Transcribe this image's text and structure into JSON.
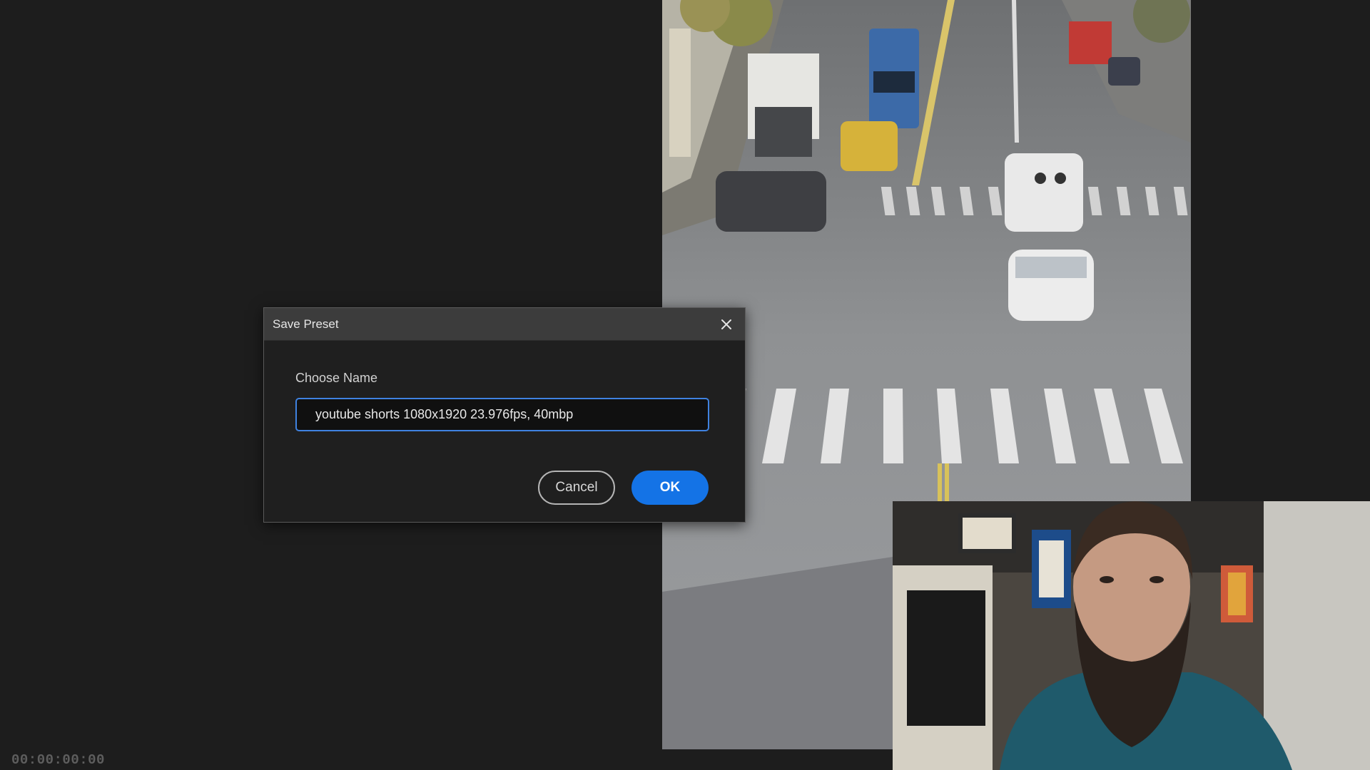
{
  "timecode": "00:00:00:00",
  "dialog": {
    "title": "Save Preset",
    "close_icon": "close-icon",
    "field_label": "Choose Name",
    "name_value": "youtube shorts 1080x1920 23.976fps, 40mbp",
    "cancel_label": "Cancel",
    "ok_label": "OK"
  },
  "colors": {
    "accent": "#1473e6",
    "focus_border": "#3f82e0",
    "background": "#1d1d1d"
  }
}
